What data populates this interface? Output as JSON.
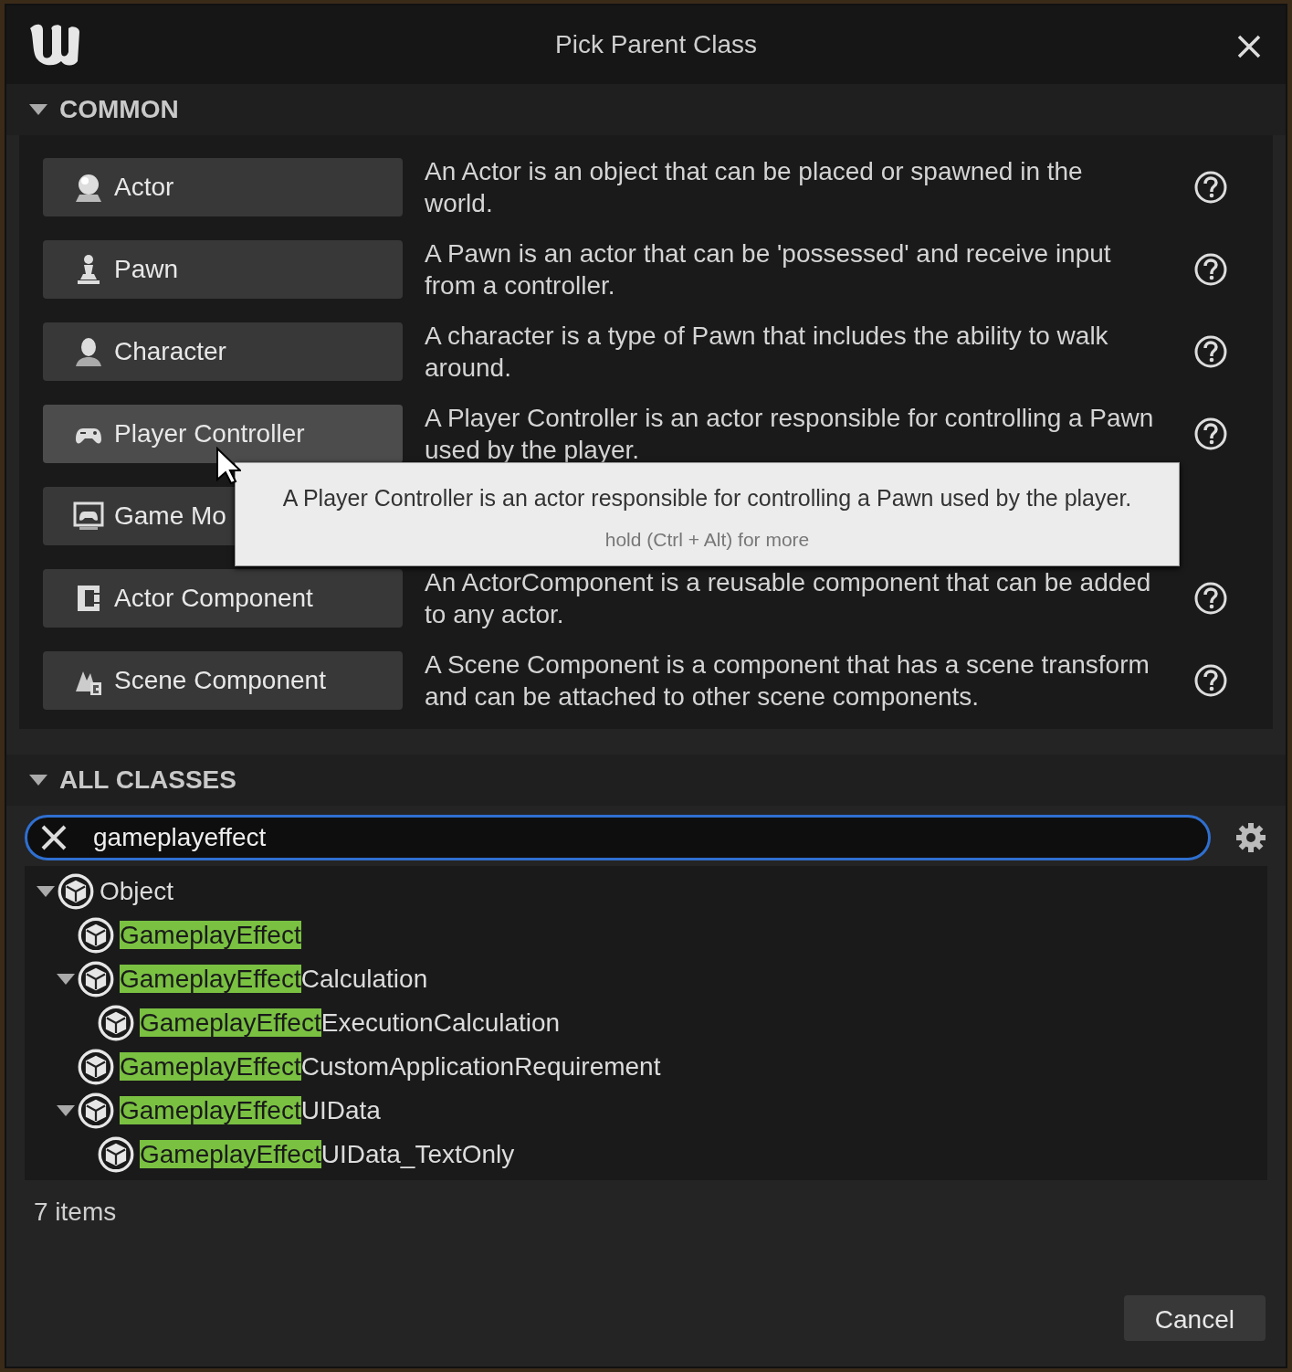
{
  "window": {
    "title": "Pick Parent Class"
  },
  "common": {
    "header": "COMMON",
    "expanded": true,
    "items": [
      {
        "kind": "actor",
        "label": "Actor",
        "description": "An Actor is an object that can be placed or spawned in the world.",
        "hovered": false
      },
      {
        "kind": "pawn",
        "label": "Pawn",
        "description": "A Pawn is an actor that can be 'possessed' and receive input from a controller.",
        "hovered": false
      },
      {
        "kind": "character",
        "label": "Character",
        "description": "A character is a type of Pawn that includes the ability to walk around.",
        "hovered": false
      },
      {
        "kind": "controller",
        "label": "Player Controller",
        "description": "A Player Controller is an actor responsible for controlling a Pawn used by the player.",
        "hovered": true
      },
      {
        "kind": "gamemode",
        "label": "Game Mo",
        "hovered": false
      },
      {
        "kind": "component",
        "label": "Actor Component",
        "description": "An ActorComponent is a reusable component that can be added to any actor.",
        "hovered": false
      },
      {
        "kind": "scene",
        "label": "Scene Component",
        "description": "A Scene Component is a component that has a scene transform and can be attached to other scene components.",
        "hovered": false
      }
    ]
  },
  "tooltip": {
    "text": "A Player Controller is an actor responsible for controlling a Pawn used by the player.",
    "hint": "hold (Ctrl + Alt) for more"
  },
  "all_classes": {
    "header": "ALL CLASSES",
    "expanded": true,
    "search": {
      "value": "gameplayeffect"
    },
    "tree": [
      {
        "rest": "Object",
        "expanded": true,
        "children": [
          {
            "match": "GameplayEffect"
          },
          {
            "match": "GameplayEffect",
            "rest": "Calculation",
            "expanded": true,
            "children": [
              {
                "match": "GameplayEffect",
                "rest": "ExecutionCalculation"
              }
            ]
          },
          {
            "match": "GameplayEffect",
            "rest": "CustomApplicationRequirement"
          },
          {
            "match": "GameplayEffect",
            "rest": "UIData",
            "expanded": true,
            "children": [
              {
                "match": "GameplayEffect",
                "rest": "UIData_TextOnly"
              }
            ]
          }
        ]
      }
    ],
    "count": "7 items"
  },
  "buttons": {
    "cancel": "Cancel"
  }
}
